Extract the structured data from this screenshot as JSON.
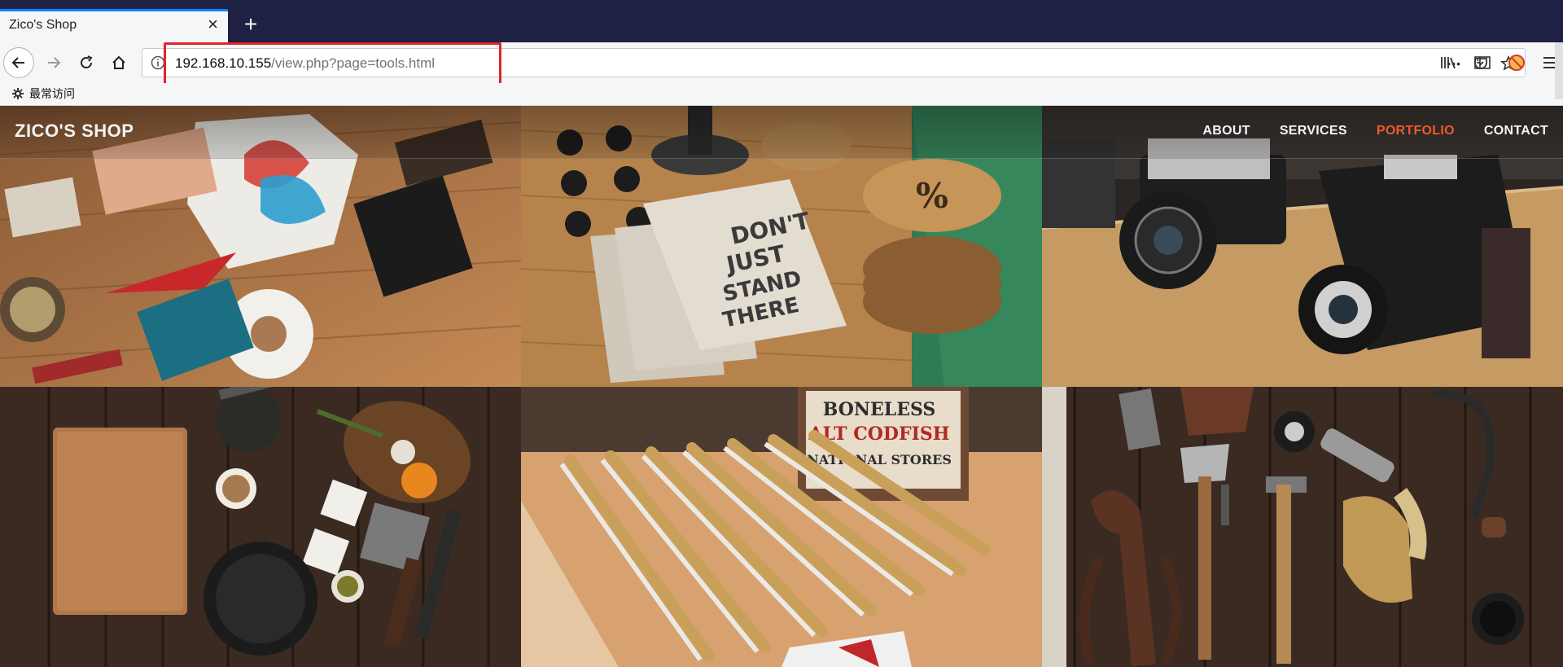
{
  "browser": {
    "tab_title": "Zico's Shop",
    "tab_close": "×",
    "new_tab": "+",
    "url_host": "192.168.10.155",
    "url_path": "/view.php?page=tools.html",
    "url_more": "•••",
    "bookmark_label": "最常访问"
  },
  "site": {
    "brand": "ZICO'S SHOP",
    "nav": [
      {
        "label": "ABOUT"
      },
      {
        "label": "SERVICES"
      },
      {
        "label": "PORTFOLIO"
      },
      {
        "label": "CONTACT"
      }
    ],
    "active_color": "#f05a28"
  },
  "tiles": [
    {
      "subject": "design desk with pennant and camera"
    },
    {
      "subject": "notebooks DON'T JUST STAND THERE"
    },
    {
      "subject": "vintage cameras"
    },
    {
      "subject": "kitchen board and spices"
    },
    {
      "subject": "folding rulers and codfish crate"
    },
    {
      "subject": "old hand tools on wood"
    }
  ]
}
